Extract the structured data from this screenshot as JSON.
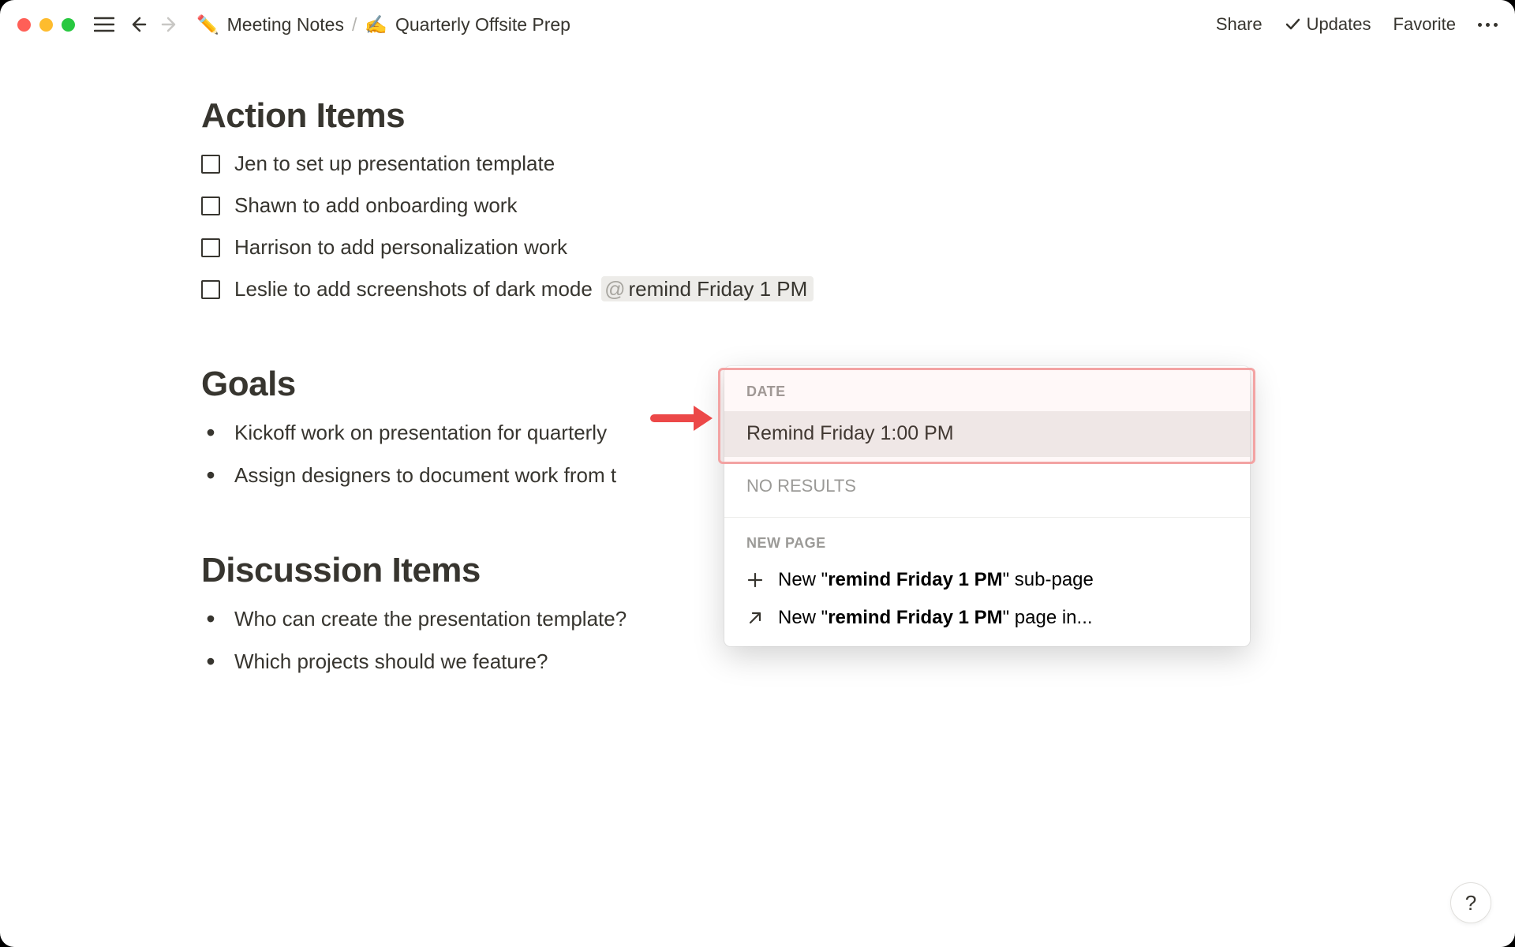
{
  "topbar": {
    "breadcrumb": {
      "parent_icon": "✏️",
      "parent": "Meeting Notes",
      "current_icon": "✍️",
      "current": "Quarterly Offsite Prep"
    },
    "share": "Share",
    "updates": "Updates",
    "favorite": "Favorite"
  },
  "sections": {
    "action_items_title": "Action Items",
    "goals_title": "Goals",
    "discussion_title": "Discussion Items"
  },
  "todos": [
    {
      "text": "Jen to set up presentation template"
    },
    {
      "text": "Shawn to add onboarding work"
    },
    {
      "text": "Harrison to add personalization work"
    },
    {
      "text": "Leslie to add screenshots of dark mode",
      "mention": "remind Friday 1 PM"
    }
  ],
  "goals": [
    "Kickoff work on presentation for quarterly",
    "Assign designers to document work from t"
  ],
  "discussion": [
    "Who can create the presentation template?",
    "Which projects should we feature?"
  ],
  "popup": {
    "date_header": "DATE",
    "date_item": "Remind Friday 1:00 PM",
    "no_results": "NO RESULTS",
    "new_page_header": "NEW PAGE",
    "sub_page_prefix": "New \"",
    "sub_page_term": "remind Friday 1 PM",
    "sub_page_suffix": "\" sub-page",
    "page_in_prefix": "New \"",
    "page_in_term": "remind Friday 1 PM",
    "page_in_suffix": "\" page in..."
  },
  "help": "?"
}
